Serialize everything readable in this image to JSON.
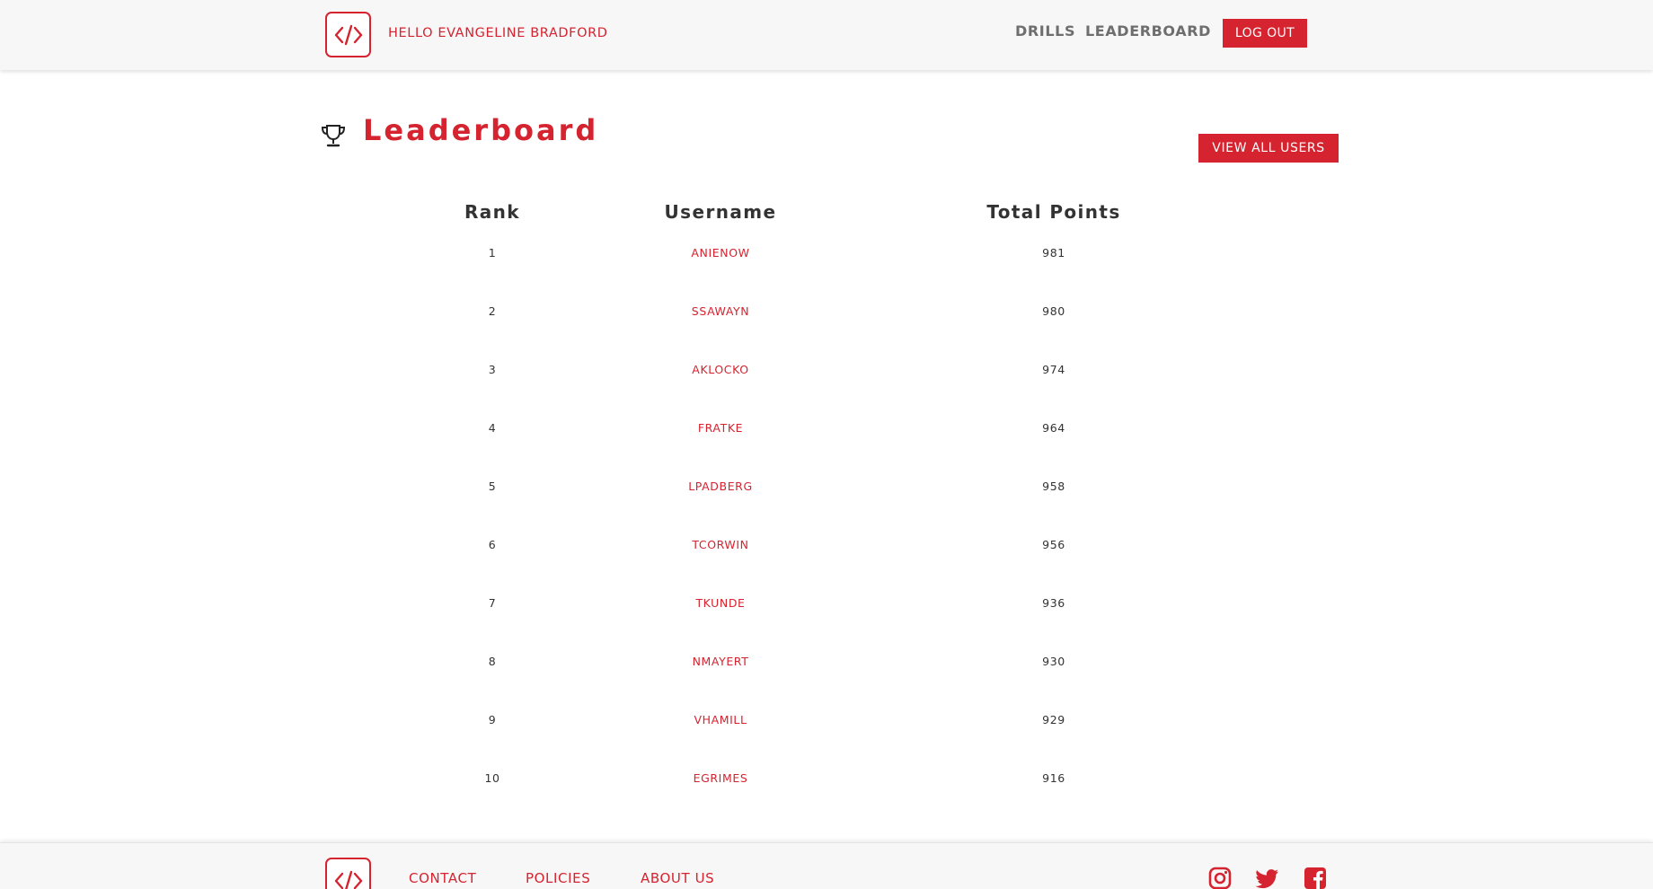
{
  "colors": {
    "brand": "#d5232f",
    "header_bg": "#f7f7f7",
    "text_dark": "#333333",
    "nav_gray": "#6e6e6e"
  },
  "header": {
    "logo_icon": "code-brackets-icon",
    "greeting": "HELLO EVANGELINE BRADFORD",
    "nav": {
      "drills": "DRILLS",
      "leaderboard": "LEADERBOARD"
    },
    "logout_label": "LOG OUT"
  },
  "main": {
    "title_icon": "trophy-icon",
    "title": "Leaderboard",
    "view_all_label": "VIEW ALL USERS",
    "table": {
      "headers": {
        "rank": "Rank",
        "username": "Username",
        "points": "Total Points"
      },
      "rows": [
        {
          "rank": "1",
          "username": "ANIENOW",
          "points": "981"
        },
        {
          "rank": "2",
          "username": "SSAWAYN",
          "points": "980"
        },
        {
          "rank": "3",
          "username": "AKLOCKO",
          "points": "974"
        },
        {
          "rank": "4",
          "username": "FRATKE",
          "points": "964"
        },
        {
          "rank": "5",
          "username": "LPADBERG",
          "points": "958"
        },
        {
          "rank": "6",
          "username": "TCORWIN",
          "points": "956"
        },
        {
          "rank": "7",
          "username": "TKUNDE",
          "points": "936"
        },
        {
          "rank": "8",
          "username": "NMAYERT",
          "points": "930"
        },
        {
          "rank": "9",
          "username": "VHAMILL",
          "points": "929"
        },
        {
          "rank": "10",
          "username": "EGRIMES",
          "points": "916"
        }
      ]
    }
  },
  "footer": {
    "logo_icon": "code-brackets-icon",
    "links": {
      "contact": "CONTACT",
      "policies": "POLICIES",
      "about": "ABOUT US"
    },
    "social": [
      "instagram-icon",
      "twitter-icon",
      "facebook-icon"
    ]
  }
}
